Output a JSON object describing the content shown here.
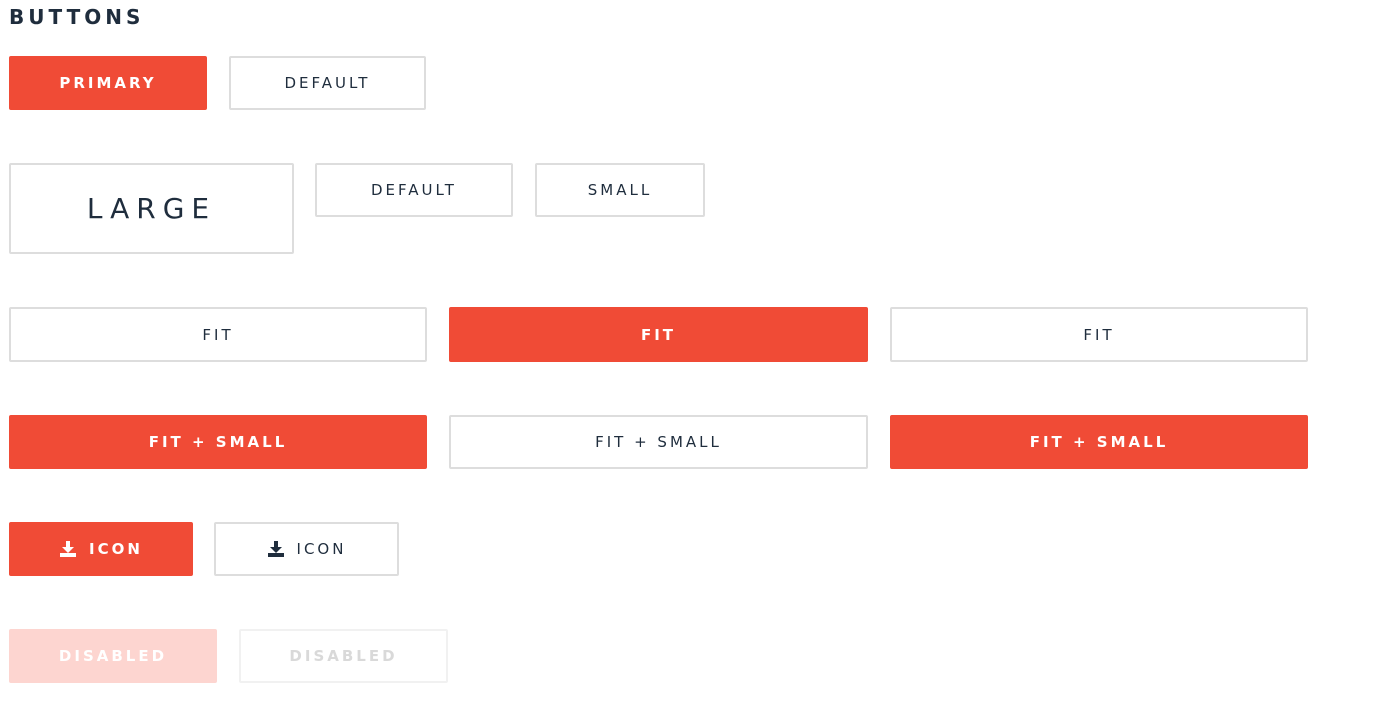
{
  "page": {
    "title": "BUTTONS"
  },
  "colors": {
    "primary": "#f04b36",
    "primary_disabled": "#fdd5d0",
    "default_border": "#dddddd",
    "text_dark": "#1f2d3d",
    "text_disabled": "#d9d9d9"
  },
  "row1": {
    "primary_label": "PRIMARY",
    "default_label": "DEFAULT"
  },
  "row2": {
    "large_label": "LARGE",
    "default_label": "DEFAULT",
    "small_label": "SMALL"
  },
  "row3": {
    "fit_1_label": "FIT",
    "fit_2_label": "FIT",
    "fit_3_label": "FIT"
  },
  "row4": {
    "fit_small_1_label": "FIT + SMALL",
    "fit_small_2_label": "FIT + SMALL",
    "fit_small_3_label": "FIT + SMALL"
  },
  "row5": {
    "icon_primary_label": "ICON",
    "icon_default_label": "ICON",
    "icon_name": "download-icon"
  },
  "row6": {
    "disabled_primary_label": "DISABLED",
    "disabled_default_label": "DISABLED"
  }
}
